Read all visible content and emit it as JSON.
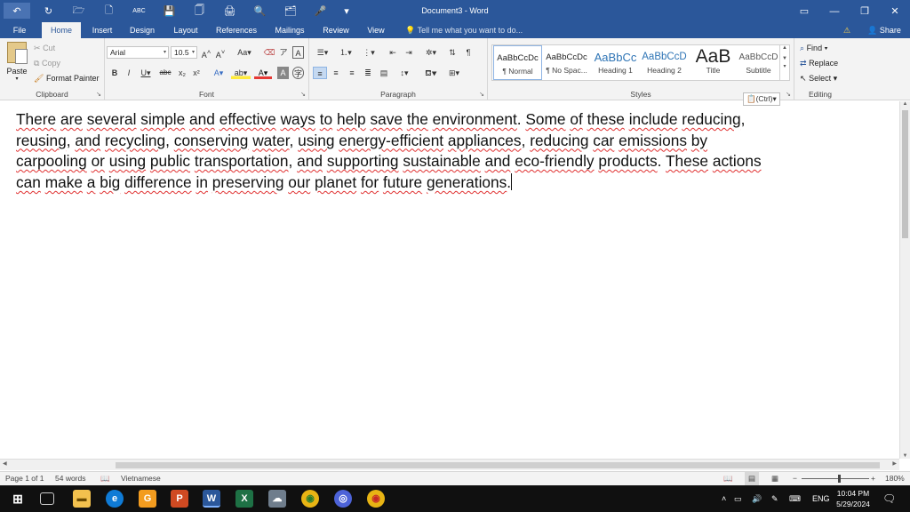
{
  "window": {
    "title": "Document3 - Word",
    "minimize": "—",
    "maximize": "❐",
    "close": "✕",
    "ribbon_display": "▭"
  },
  "qat": [
    "↶",
    "↻",
    "🗁",
    "🗋",
    "ABC",
    "💾",
    "🗍",
    "🖨",
    "🔍",
    "🗂",
    "🎤",
    "▾"
  ],
  "tabs": [
    "File",
    "Home",
    "Insert",
    "Design",
    "Layout",
    "References",
    "Mailings",
    "Review",
    "View"
  ],
  "tell_me": "Tell me what you want to do...",
  "warning_icon": "⚠",
  "share": "Share",
  "clipboard": {
    "paste": "Paste",
    "cut": "Cut",
    "copy": "Copy",
    "format_painter": "Format Painter",
    "label": "Clipboard"
  },
  "font": {
    "name": "Arial",
    "size": "10.5",
    "label": "Font"
  },
  "paragraph": {
    "label": "Paragraph"
  },
  "styles": {
    "items": [
      {
        "preview": "AaBbCcDc",
        "name": "¶ Normal"
      },
      {
        "preview": "AaBbCcDc",
        "name": "¶ No Spac..."
      },
      {
        "preview": "AaBbCc",
        "name": "Heading 1"
      },
      {
        "preview": "AaBbCcD",
        "name": "Heading 2"
      },
      {
        "preview": "AaB",
        "name": "Title"
      },
      {
        "preview": "AaBbCcD",
        "name": "Subtitle"
      }
    ],
    "label": "Styles"
  },
  "editing": {
    "find": "Find",
    "replace": "Replace",
    "select": "Select",
    "label": "Editing"
  },
  "document": {
    "text": "There are several simple and effective ways to help save the environment. Some of these include reducing, reusing, and recycling, conserving water, using energy-efficient appliances, reducing car emissions by carpooling or using public transportation, and supporting sustainable and eco-friendly products. These actions can make a big difference in preserving our planet for future generations."
  },
  "paste_options": "(Ctrl)",
  "status": {
    "page": "Page 1 of 1",
    "words": "54 words",
    "language": "Vietnamese",
    "zoom": "180%",
    "zoom_level": 0.55
  },
  "taskbar": {
    "input_lang": "ENG",
    "time": "10:04 PM",
    "date": "5/29/2024"
  },
  "colors": {
    "accent": "#2b579a",
    "ribbon_bg": "#f3f3f3",
    "spell_underline": "#e03030",
    "taskbar": "#101010"
  }
}
